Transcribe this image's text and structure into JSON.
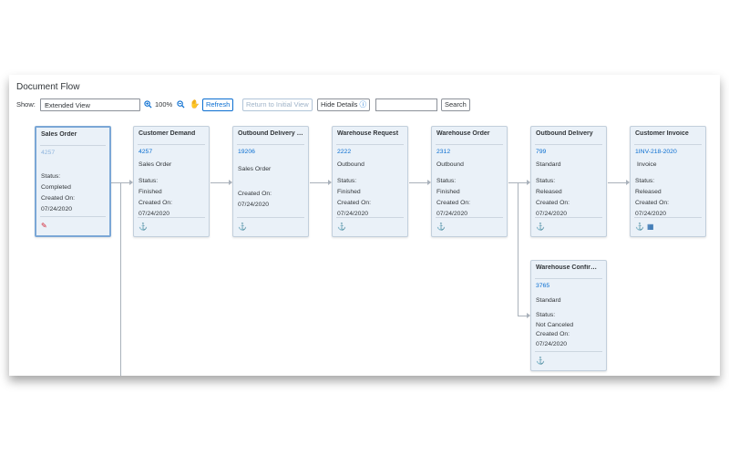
{
  "panel": {
    "title": "Document Flow"
  },
  "toolbar": {
    "show_label": "Show:",
    "view_value": "Extended View",
    "zoom_level": "100%",
    "refresh_label": "Refresh",
    "reset_label": "Return to Initial View",
    "details_label": "Hide Details",
    "search_value": "",
    "search_label": "Search"
  },
  "nodes": {
    "sales_order": {
      "title": "Sales Order",
      "id": "4257",
      "status_label": "Status:",
      "status": "Completed",
      "created_label": "Created On:",
      "date": "07/24/2020"
    },
    "customer_demand": {
      "title": "Customer Demand",
      "id": "4257",
      "type": "Sales Order",
      "status_label": "Status:",
      "status": "Finished",
      "created_label": "Created On:",
      "date": "07/24/2020"
    },
    "outbound_delivery_request": {
      "title": "Outbound Delivery R...",
      "id": "19206",
      "type": "Sales Order",
      "created_label": "Created On:",
      "date": "07/24/2020"
    },
    "warehouse_request": {
      "title": "Warehouse Request",
      "id": "2222",
      "type": "Outbound",
      "status_label": "Status:",
      "status": "Finished",
      "created_label": "Created On:",
      "date": "07/24/2020"
    },
    "warehouse_order": {
      "title": "Warehouse Order",
      "id": "2312",
      "type": "Outbound",
      "status_label": "Status:",
      "status": "Finished",
      "created_label": "Created On:",
      "date": "07/24/2020"
    },
    "outbound_delivery": {
      "title": "Outbound Delivery",
      "id": "799",
      "type": "Standard",
      "status_label": "Status:",
      "status": "Released",
      "created_label": "Created On:",
      "date": "07/24/2020"
    },
    "customer_invoice": {
      "title": "Customer Invoice",
      "id": "1INV-218-2020",
      "type": "Invoice",
      "status_label": "Status:",
      "status": "Released",
      "created_label": "Created On:",
      "date": "07/24/2020"
    },
    "warehouse_confirmation": {
      "title": "Warehouse Confirmat...",
      "id": "3765",
      "type": "Standard",
      "status_label": "Status:",
      "status": "Not Canceled",
      "created_label": "Created On:",
      "date": "07/24/2020"
    }
  },
  "colors": {
    "accent": "#0a6ed1",
    "card_bg": "#eaf1f8",
    "connector": "#aab2bb"
  }
}
